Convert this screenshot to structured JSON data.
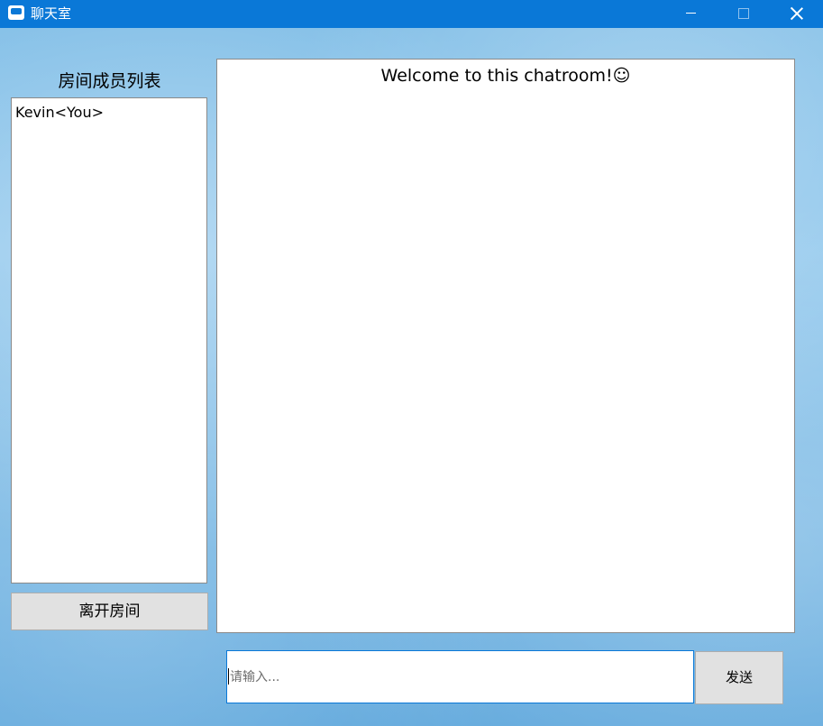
{
  "window": {
    "title": "聊天室",
    "icon": "chat-bubble-icon",
    "controls": {
      "minimize": "minimize-icon",
      "maximize": "maximize-icon",
      "close": "close-icon"
    },
    "colors": {
      "titlebar": "#0a78d7",
      "button_face": "#e1e1e1",
      "input_focus_border": "#0a78d7"
    }
  },
  "members": {
    "heading": "房间成员列表",
    "items": [
      {
        "label": "Kevin<You>"
      }
    ],
    "leave_label": "离开房间"
  },
  "chat": {
    "welcome": "Welcome to this chatroom!☺"
  },
  "composer": {
    "value": "",
    "placeholder": "请输入...",
    "send_label": "发送"
  }
}
